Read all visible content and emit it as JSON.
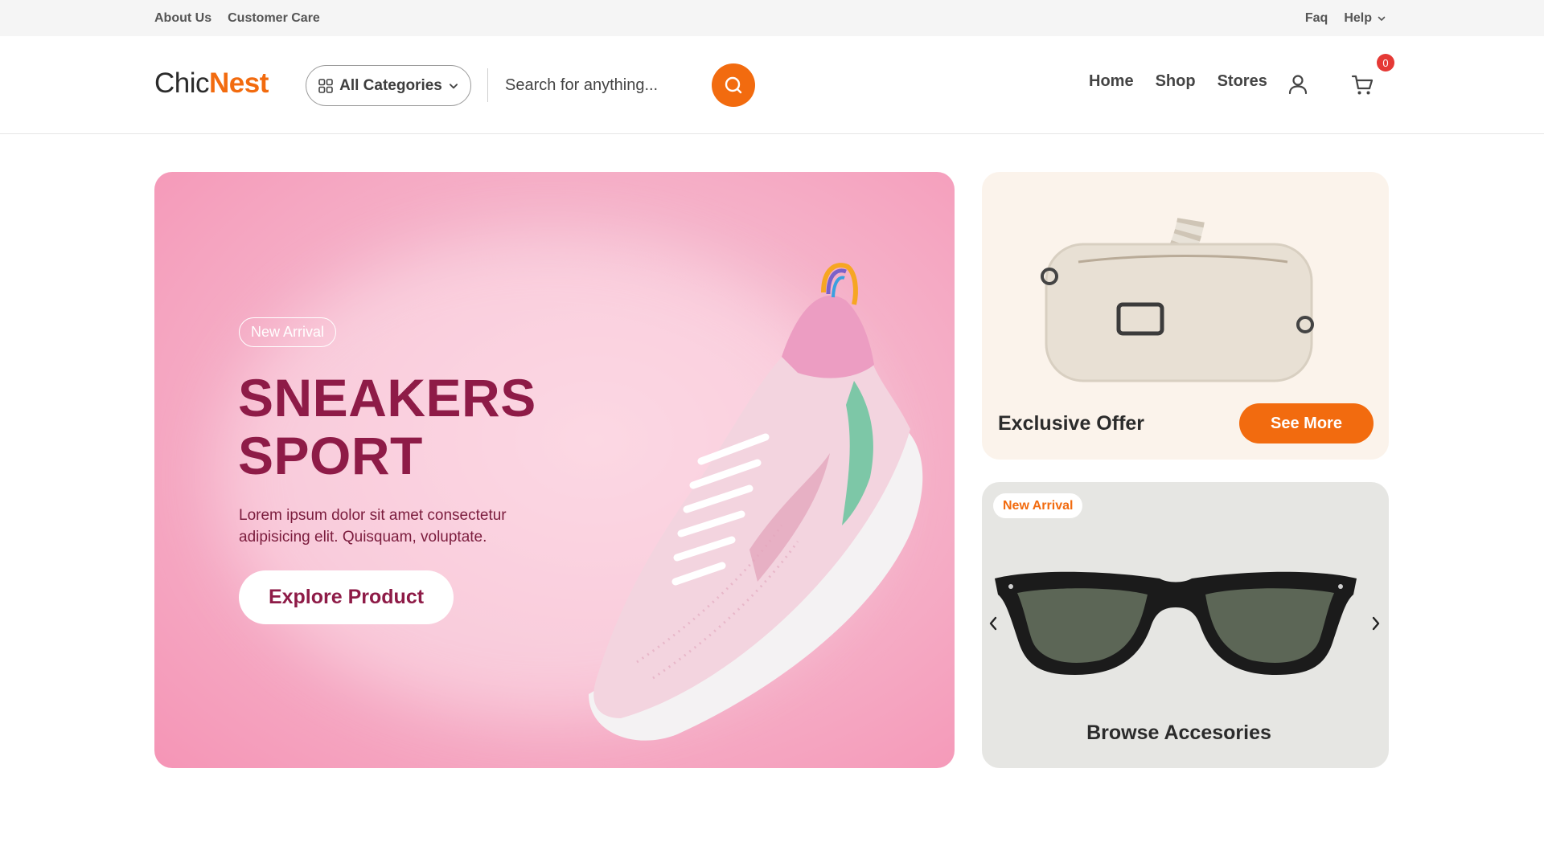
{
  "topbar": {
    "left_links": [
      "About Us",
      "Customer Care"
    ],
    "faq": "Faq",
    "help": "Help"
  },
  "header": {
    "logo_part1": "Chic",
    "logo_part2": "Nest",
    "categories_label": "All Categories",
    "search_placeholder": "Search for anything...",
    "nav": [
      "Home",
      "Shop",
      "Stores"
    ],
    "cart_count": "0"
  },
  "hero": {
    "badge": "New Arrival",
    "title_line1": "SNEAKERS",
    "title_line2": "SPORT",
    "description": "Lorem ipsum dolor sit amet consectetur adipisicing elit. Quisquam, voluptate.",
    "cta": "Explore Product"
  },
  "offer": {
    "title": "Exclusive Offer",
    "cta": "See More"
  },
  "accessories": {
    "badge": "New Arrival",
    "title": "Browse Accesories"
  },
  "colors": {
    "accent": "#f26b0f",
    "hero_text": "#8e1b47",
    "hero_bg": "#f5b5cb",
    "badge_red": "#e53935"
  },
  "icons": [
    "grid-icon",
    "chevron-down-icon",
    "search-icon",
    "user-icon",
    "cart-icon",
    "chevron-left-icon",
    "chevron-right-icon"
  ]
}
